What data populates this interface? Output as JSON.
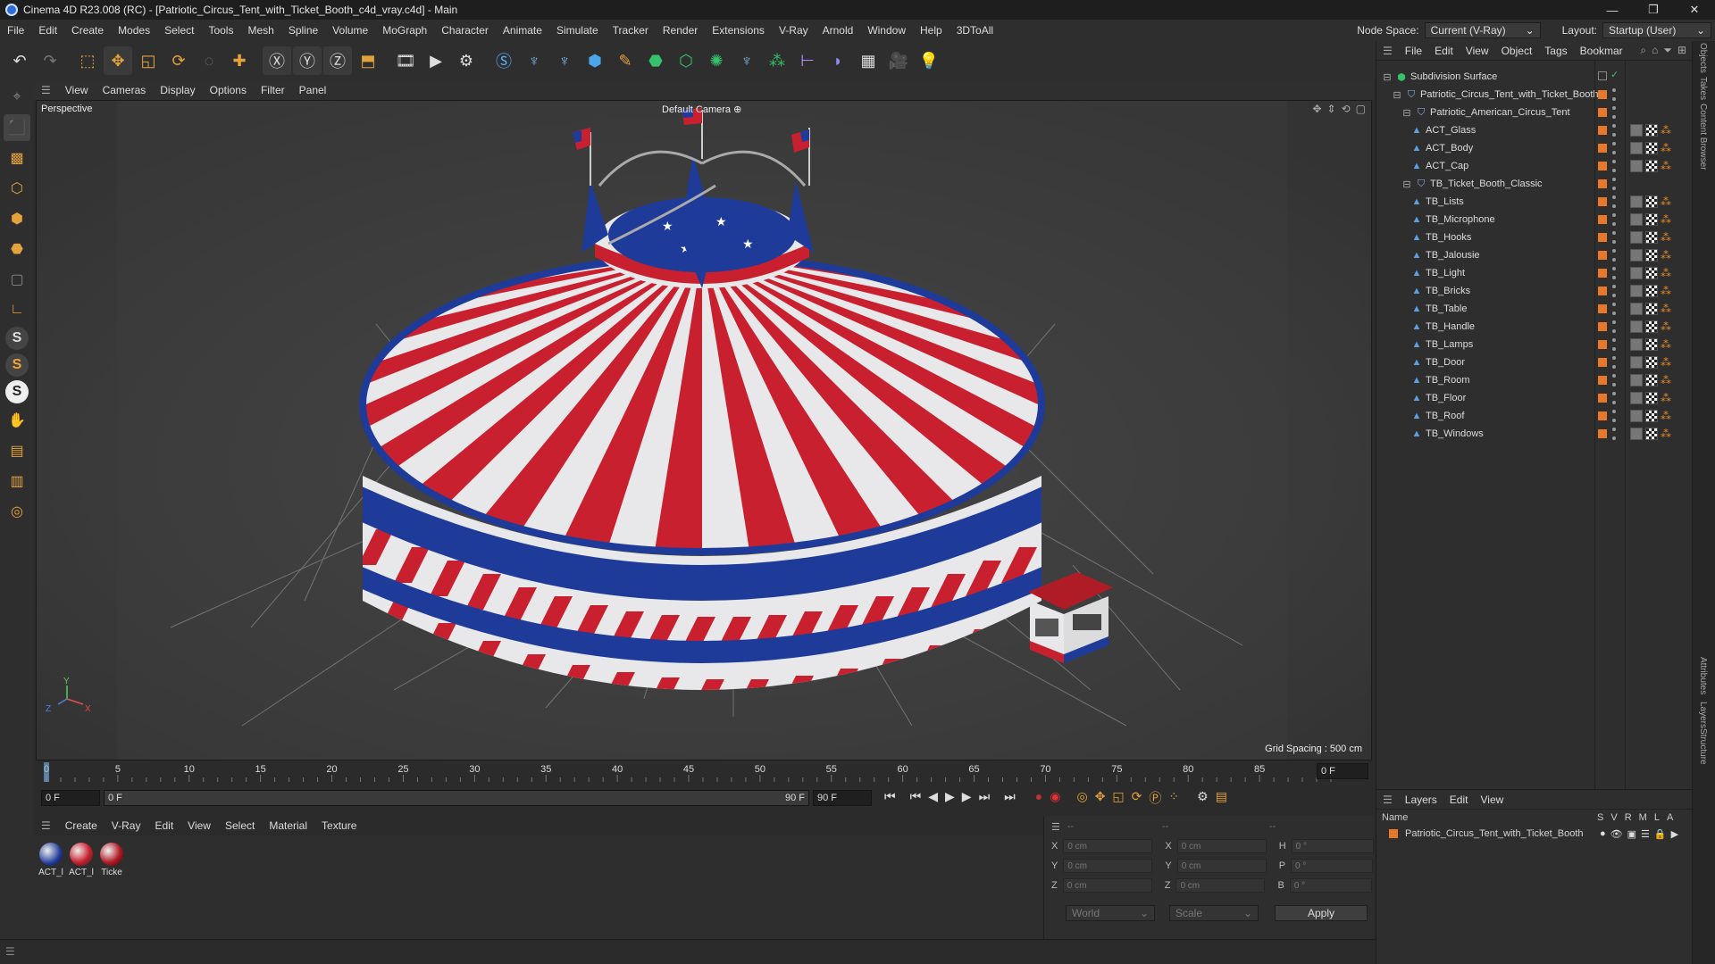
{
  "window": {
    "title": "Cinema 4D R23.008 (RC) - [Patriotic_Circus_Tent_with_Ticket_Booth_c4d_vray.c4d] - Main",
    "controls": [
      "—",
      "❐",
      "✕"
    ]
  },
  "menubar": [
    "File",
    "Edit",
    "Create",
    "Modes",
    "Select",
    "Tools",
    "Mesh",
    "Spline",
    "Volume",
    "MoGraph",
    "Character",
    "Animate",
    "Simulate",
    "Tracker",
    "Render",
    "Extensions",
    "V-Ray",
    "Arnold",
    "Window",
    "Help",
    "3DToAll"
  ],
  "nodespace": {
    "label": "Node Space:",
    "value": "Current (V-Ray)",
    "layout_label": "Layout:",
    "layout_value": "Startup (User)"
  },
  "viewport": {
    "menu": [
      "View",
      "Cameras",
      "Display",
      "Options",
      "Filter",
      "Panel"
    ],
    "label": "Perspective",
    "camera": "Default Camera",
    "grid_spacing": "Grid Spacing : 500 cm",
    "axis": {
      "y": "Y",
      "z": "Z",
      "x": "X"
    }
  },
  "timeline": {
    "ticks": [
      "0",
      "5",
      "10",
      "15",
      "20",
      "25",
      "30",
      "35",
      "40",
      "45",
      "50",
      "55",
      "60",
      "65",
      "70",
      "75",
      "80",
      "85",
      "90"
    ],
    "current": "0 F"
  },
  "transport": {
    "start": "0 F",
    "range_start": "0 F",
    "range_end": "90 F",
    "end": "90 F"
  },
  "material_manager": {
    "menu": [
      "Create",
      "V-Ray",
      "Edit",
      "View",
      "Select",
      "Material",
      "Texture"
    ],
    "materials": [
      {
        "label": "ACT_l"
      },
      {
        "label": "ACT_l"
      },
      {
        "label": "Ticke"
      }
    ]
  },
  "coords": {
    "header": [
      "--",
      "--",
      "--"
    ],
    "rows": [
      {
        "a": "X",
        "av": "0 cm",
        "b": "X",
        "bv": "0 cm",
        "c": "H",
        "cv": "0 °"
      },
      {
        "a": "Y",
        "av": "0 cm",
        "b": "Y",
        "bv": "0 cm",
        "c": "P",
        "cv": "0 °"
      },
      {
        "a": "Z",
        "av": "0 cm",
        "b": "Z",
        "bv": "0 cm",
        "c": "B",
        "cv": "0 °"
      }
    ],
    "world": "World",
    "scale": "Scale",
    "apply": "Apply"
  },
  "object_manager": {
    "menu": [
      "File",
      "Edit",
      "View",
      "Object",
      "Tags",
      "Bookmar"
    ],
    "objects": [
      {
        "name": "Subdivision Surface",
        "indent": 0,
        "tag": false,
        "mat": false
      },
      {
        "name": "Patriotic_Circus_Tent_with_Ticket_Booth",
        "indent": 1,
        "tag": true,
        "mat": false
      },
      {
        "name": "Patriotic_American_Circus_Tent",
        "indent": 2,
        "tag": true,
        "mat": false
      },
      {
        "name": "ACT_Glass",
        "indent": 3,
        "tag": true,
        "mat": true
      },
      {
        "name": "ACT_Body",
        "indent": 3,
        "tag": true,
        "mat": true
      },
      {
        "name": "ACT_Cap",
        "indent": 3,
        "tag": true,
        "mat": true
      },
      {
        "name": "TB_Ticket_Booth_Classic",
        "indent": 2,
        "tag": true,
        "mat": false
      },
      {
        "name": "TB_Lists",
        "indent": 3,
        "tag": true,
        "mat": true
      },
      {
        "name": "TB_Microphone",
        "indent": 3,
        "tag": true,
        "mat": true
      },
      {
        "name": "TB_Hooks",
        "indent": 3,
        "tag": true,
        "mat": true
      },
      {
        "name": "TB_Jalousie",
        "indent": 3,
        "tag": true,
        "mat": true
      },
      {
        "name": "TB_Light",
        "indent": 3,
        "tag": true,
        "mat": true
      },
      {
        "name": "TB_Bricks",
        "indent": 3,
        "tag": true,
        "mat": true
      },
      {
        "name": "TB_Table",
        "indent": 3,
        "tag": true,
        "mat": true
      },
      {
        "name": "TB_Handle",
        "indent": 3,
        "tag": true,
        "mat": true
      },
      {
        "name": "TB_Lamps",
        "indent": 3,
        "tag": true,
        "mat": true
      },
      {
        "name": "TB_Door",
        "indent": 3,
        "tag": true,
        "mat": true
      },
      {
        "name": "TB_Room",
        "indent": 3,
        "tag": true,
        "mat": true
      },
      {
        "name": "TB_Floor",
        "indent": 3,
        "tag": true,
        "mat": true
      },
      {
        "name": "TB_Roof",
        "indent": 3,
        "tag": true,
        "mat": true
      },
      {
        "name": "TB_Windows",
        "indent": 3,
        "tag": true,
        "mat": true
      }
    ]
  },
  "layers": {
    "menu": [
      "Layers",
      "Edit",
      "View"
    ],
    "columns": {
      "name": "Name",
      "flags": [
        "S",
        "V",
        "R",
        "M",
        "L",
        "A"
      ]
    },
    "rows": [
      {
        "name": "Patriotic_Circus_Tent_with_Ticket_Booth"
      }
    ]
  },
  "right_tabs": [
    "Objects",
    "Takes",
    "Content Browser",
    "Attributes",
    "Layers",
    "Structure"
  ],
  "colors": {
    "accent": "#e67a2a",
    "tent_red": "#c8202e",
    "tent_blue": "#1f3b9a",
    "tent_white": "#e8e8ea"
  }
}
